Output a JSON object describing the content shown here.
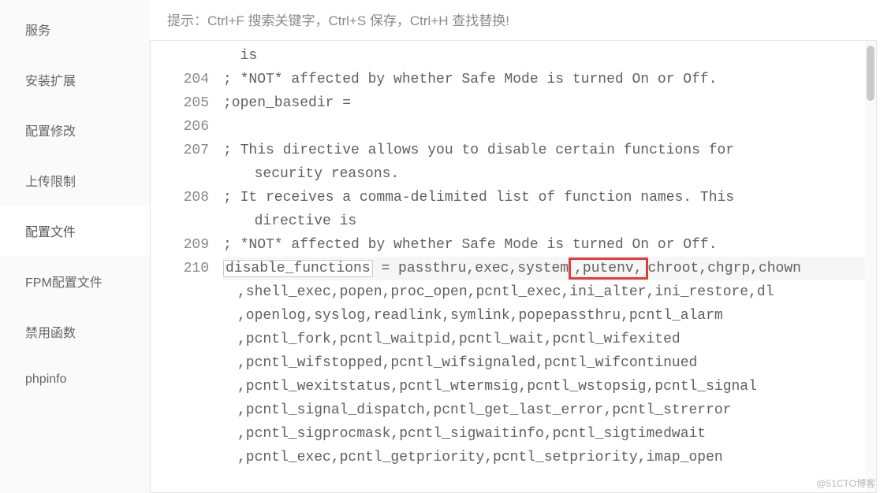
{
  "sidebar": {
    "items": [
      {
        "label": "服务",
        "active": false
      },
      {
        "label": "安装扩展",
        "active": false
      },
      {
        "label": "配置修改",
        "active": false
      },
      {
        "label": "上传限制",
        "active": false
      },
      {
        "label": "配置文件",
        "active": true
      },
      {
        "label": "FPM配置文件",
        "active": false
      },
      {
        "label": "禁用函数",
        "active": false
      },
      {
        "label": "phpinfo",
        "active": false
      }
    ]
  },
  "hint": "提示：Ctrl+F 搜索关键字，Ctrl+S 保存，Ctrl+H 查找替换!",
  "editor": {
    "highlighted_keyword": "disable_functions",
    "red_box_word": ",putenv,",
    "lines": [
      {
        "num": "",
        "parts": [
          "  is"
        ]
      },
      {
        "num": "204",
        "parts": [
          "; *NOT* affected by whether Safe Mode is turned On or Off."
        ]
      },
      {
        "num": "205",
        "parts": [
          ";open_basedir ="
        ]
      },
      {
        "num": "206",
        "parts": [
          ""
        ]
      },
      {
        "num": "207",
        "parts": [
          "; This directive allows you to disable certain functions for",
          "  security reasons."
        ]
      },
      {
        "num": "208",
        "parts": [
          "; It receives a comma-delimited list of function names. This",
          "  directive is"
        ]
      },
      {
        "num": "209",
        "parts": [
          "; *NOT* affected by whether Safe Mode is turned On or Off."
        ]
      },
      {
        "num": "210",
        "hl": true,
        "special": "disable_line"
      },
      {
        "num": "",
        "wrap": true,
        "parts": [
          ",shell_exec,popen,proc_open,pcntl_exec,ini_alter,ini_restore,dl"
        ]
      },
      {
        "num": "",
        "wrap": true,
        "parts": [
          ",openlog,syslog,readlink,symlink,popepassthru,pcntl_alarm"
        ]
      },
      {
        "num": "",
        "wrap": true,
        "parts": [
          ",pcntl_fork,pcntl_waitpid,pcntl_wait,pcntl_wifexited"
        ]
      },
      {
        "num": "",
        "wrap": true,
        "parts": [
          ",pcntl_wifstopped,pcntl_wifsignaled,pcntl_wifcontinued"
        ]
      },
      {
        "num": "",
        "wrap": true,
        "parts": [
          ",pcntl_wexitstatus,pcntl_wtermsig,pcntl_wstopsig,pcntl_signal"
        ]
      },
      {
        "num": "",
        "wrap": true,
        "parts": [
          ",pcntl_signal_dispatch,pcntl_get_last_error,pcntl_strerror"
        ]
      },
      {
        "num": "",
        "wrap": true,
        "parts": [
          ",pcntl_sigprocmask,pcntl_sigwaitinfo,pcntl_sigtimedwait"
        ]
      },
      {
        "num": "",
        "wrap": true,
        "parts": [
          ",pcntl_exec,pcntl_getpriority,pcntl_setpriority,imap_open"
        ]
      }
    ],
    "disable_line": {
      "before": " = passthru,exec,system",
      "after": "chroot,chgrp,chown"
    }
  },
  "watermark": "@51CTO博客"
}
